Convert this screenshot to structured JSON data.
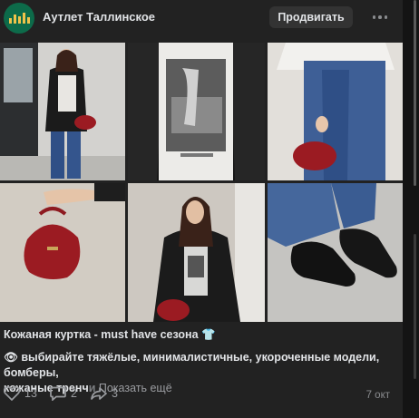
{
  "header": {
    "group_name": "Аутлет Таллинское",
    "promote_label": "Продвигать"
  },
  "post": {
    "title": "Кожаная куртка - must have сезона 👕",
    "text_line1": "👁 выбирайте тяжёлые, минималистичные, укороченные модели, бомберы,",
    "text_line2_visible": "кожаные тренч",
    "text_line2_faded": "и",
    "show_more": "Показать ещё",
    "photos": [
      "photo-1",
      "photo-2",
      "photo-3",
      "photo-4",
      "photo-5",
      "photo-6"
    ]
  },
  "actions": {
    "likes": "13",
    "comments": "2",
    "shares": "3",
    "date": "7 окт"
  },
  "colors": {
    "background": "#141414",
    "card": "#222222",
    "button": "#333333",
    "text": "#e1e3e6",
    "muted": "#9a9ca0",
    "bag_red": "#9b1b22"
  },
  "icons": [
    "heart-icon",
    "comment-icon",
    "share-icon",
    "more-icon"
  ]
}
